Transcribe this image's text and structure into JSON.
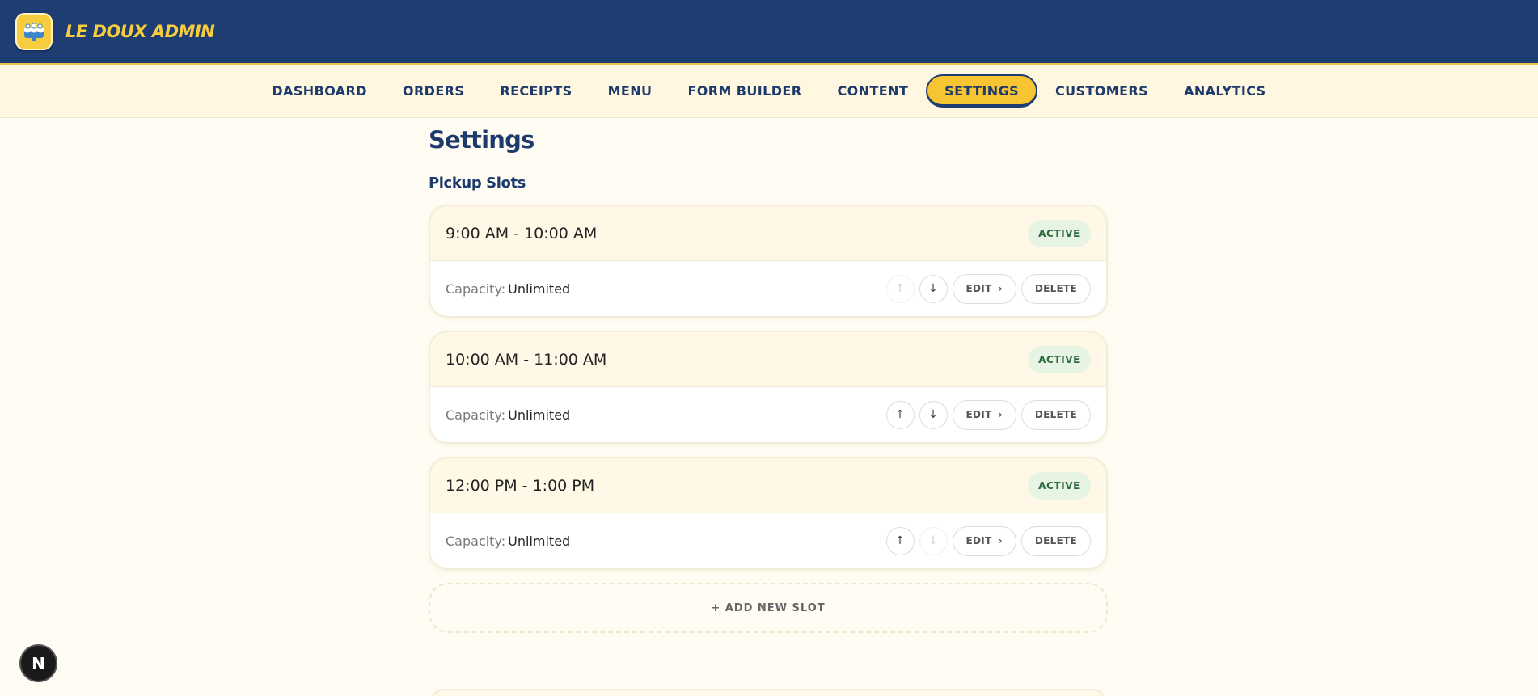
{
  "app": {
    "brand": "LE DOUX ADMIN",
    "logo_icon": "cake-logo-icon",
    "brand_color": "#f7cd3f",
    "header_color": "#1e3d72"
  },
  "nav": {
    "items": [
      {
        "label": "DASHBOARD",
        "active": false
      },
      {
        "label": "ORDERS",
        "active": false
      },
      {
        "label": "RECEIPTS",
        "active": false
      },
      {
        "label": "MENU",
        "active": false
      },
      {
        "label": "FORM BUILDER",
        "active": false
      },
      {
        "label": "CONTENT",
        "active": false
      },
      {
        "label": "SETTINGS",
        "active": true
      },
      {
        "label": "CUSTOMERS",
        "active": false
      },
      {
        "label": "ANALYTICS",
        "active": false
      }
    ]
  },
  "page": {
    "title": "Settings",
    "section_title": "Pickup Slots"
  },
  "slots": [
    {
      "time": "9:00 AM - 10:00 AM",
      "status": "ACTIVE",
      "capacity_label": "Capacity:",
      "capacity_value": "Unlimited",
      "up_enabled": false,
      "down_enabled": true,
      "edit_label": "EDIT",
      "delete_label": "DELETE"
    },
    {
      "time": "10:00 AM - 11:00 AM",
      "status": "ACTIVE",
      "capacity_label": "Capacity:",
      "capacity_value": "Unlimited",
      "up_enabled": true,
      "down_enabled": true,
      "edit_label": "EDIT",
      "delete_label": "DELETE"
    },
    {
      "time": "12:00 PM - 1:00 PM",
      "status": "ACTIVE",
      "capacity_label": "Capacity:",
      "capacity_value": "Unlimited",
      "up_enabled": true,
      "down_enabled": false,
      "edit_label": "EDIT",
      "delete_label": "DELETE"
    }
  ],
  "add_slot_label": "+ ADD NEW SLOT",
  "dev_badge": {
    "letter": "N",
    "icon": "nextjs-icon"
  }
}
